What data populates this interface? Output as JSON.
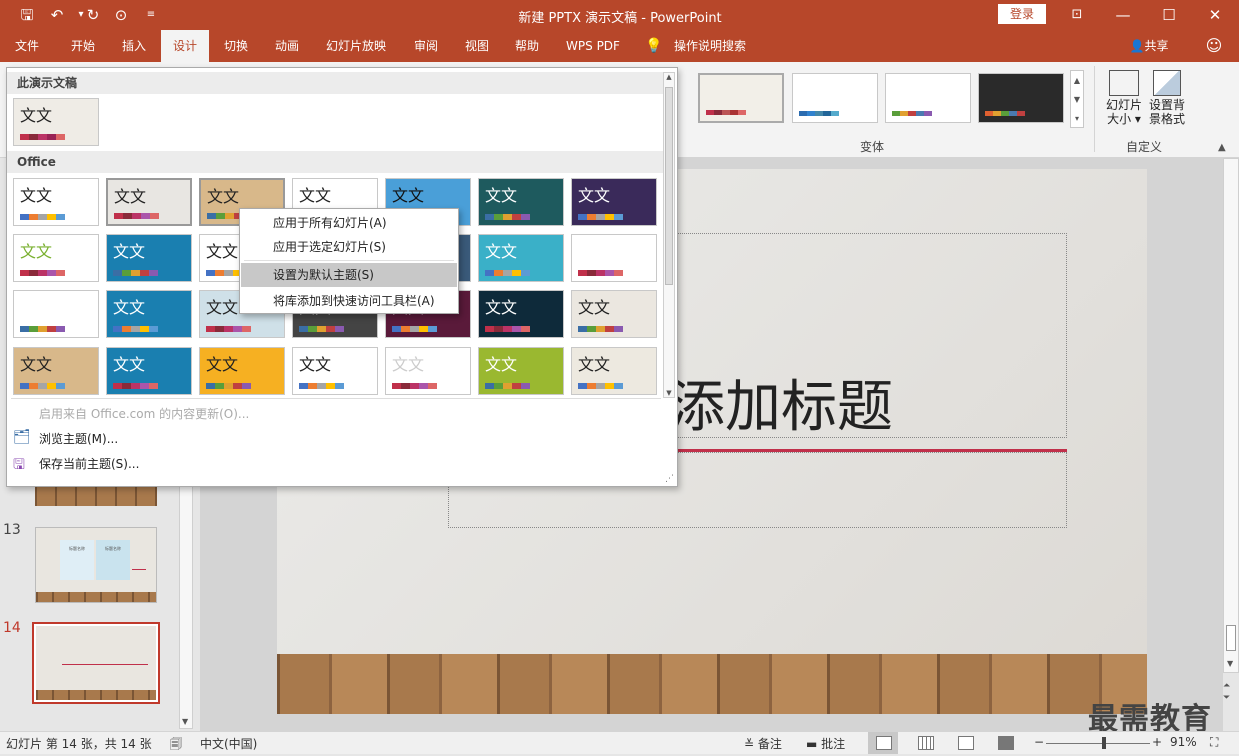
{
  "window": {
    "title": "新建 PPTX 演示文稿 - PowerPoint",
    "login": "登录"
  },
  "tabs": [
    "文件",
    "开始",
    "插入",
    "设计",
    "切换",
    "动画",
    "幻灯片放映",
    "审阅",
    "视图",
    "帮助",
    "WPS PDF",
    "操作说明搜索"
  ],
  "active_tab": "设计",
  "share": "共享",
  "ribbon": {
    "variants_group": "变体",
    "customize_group": "自定义",
    "slide_size": [
      "幻灯片",
      "大小"
    ],
    "format_bg": [
      "设置背",
      "景格式"
    ]
  },
  "gallery": {
    "section_this": "此演示文稿",
    "section_office": "Office",
    "thumb_text": "文文",
    "footer": [
      {
        "label": "启用来自 Office.com 的内容更新(O)...",
        "disabled": true
      },
      {
        "label": "浏览主题(M)...",
        "disabled": false
      },
      {
        "label": "保存当前主题(S)...",
        "disabled": false
      }
    ]
  },
  "context_menu": [
    "应用于所有幻灯片(A)",
    "应用于选定幻灯片(S)",
    "设置为默认主题(S)",
    "将库添加到快速访问工具栏(A)"
  ],
  "slides_pane": {
    "numbers": [
      "13",
      "14"
    ],
    "thumb13_labels": [
      "标题名称",
      "标题名称"
    ]
  },
  "slide": {
    "title_visible": "添加标题"
  },
  "status": {
    "slide_info": "幻灯片 第 14 张，共 14 张",
    "language": "中文(中国)",
    "notes": "备注",
    "comments": "批注",
    "zoom": "91%",
    "zoom_fraction": 0.56
  },
  "watermark": "最需教育",
  "colors": {
    "accent": "#b7472a",
    "ribbon_bg": "#f3f3f3",
    "slide_line": "#c0304a"
  }
}
